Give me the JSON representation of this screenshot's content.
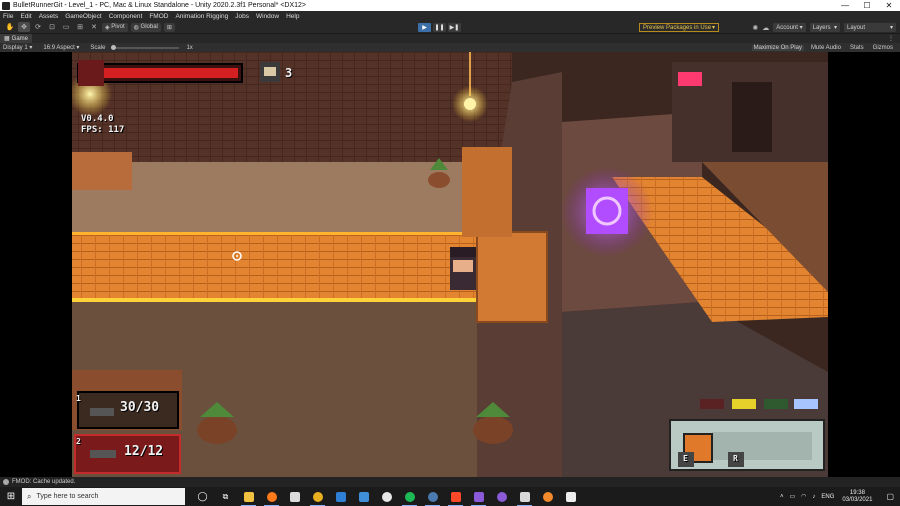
{
  "window": {
    "title": "BulletRunnerGit - Level_1 - PC, Mac & Linux Standalone - Unity 2020.2.3f1 Personal* <DX12>",
    "controls": [
      "—",
      "☐",
      "✕"
    ]
  },
  "menu": [
    "File",
    "Edit",
    "Assets",
    "GameObject",
    "Component",
    "FMOD",
    "Animation Rigging",
    "Jobs",
    "Window",
    "Help"
  ],
  "toolbar": {
    "pivot_label": "Pivot",
    "global_label": "Global",
    "preview_packages": "Preview Packages in Use",
    "account": "Account",
    "layers": "Layers",
    "layout": "Layout"
  },
  "tab": {
    "game": "Game"
  },
  "gamebar": {
    "display": "Display 1",
    "aspect": "16:9 Aspect",
    "scale_label": "Scale",
    "scale_value": "1x",
    "maximize": "Maximize On Play",
    "mute": "Mute Audio",
    "stats": "Stats",
    "gizmos": "Gizmos"
  },
  "hud": {
    "version": "V0.4.0",
    "fps": "FPS: 117",
    "coin_count": "3",
    "weapon1_slot": "1",
    "weapon1_ammo": "30/30",
    "weapon2_slot": "2",
    "weapon2_ammo": "12/12",
    "key_e": "E",
    "key_r": "R",
    "health_fraction": 1.0
  },
  "status": {
    "message": "FMOD: Cache updated."
  },
  "taskbar": {
    "search_placeholder": "Type here to search",
    "lang": "ENG",
    "time": "19:38",
    "date": "03/03/2021"
  },
  "colors": {
    "accent_play": "#3d6fa8",
    "health_red": "#d42020",
    "floor_orange": "#e7882d",
    "portal_purple": "#b24cff"
  }
}
